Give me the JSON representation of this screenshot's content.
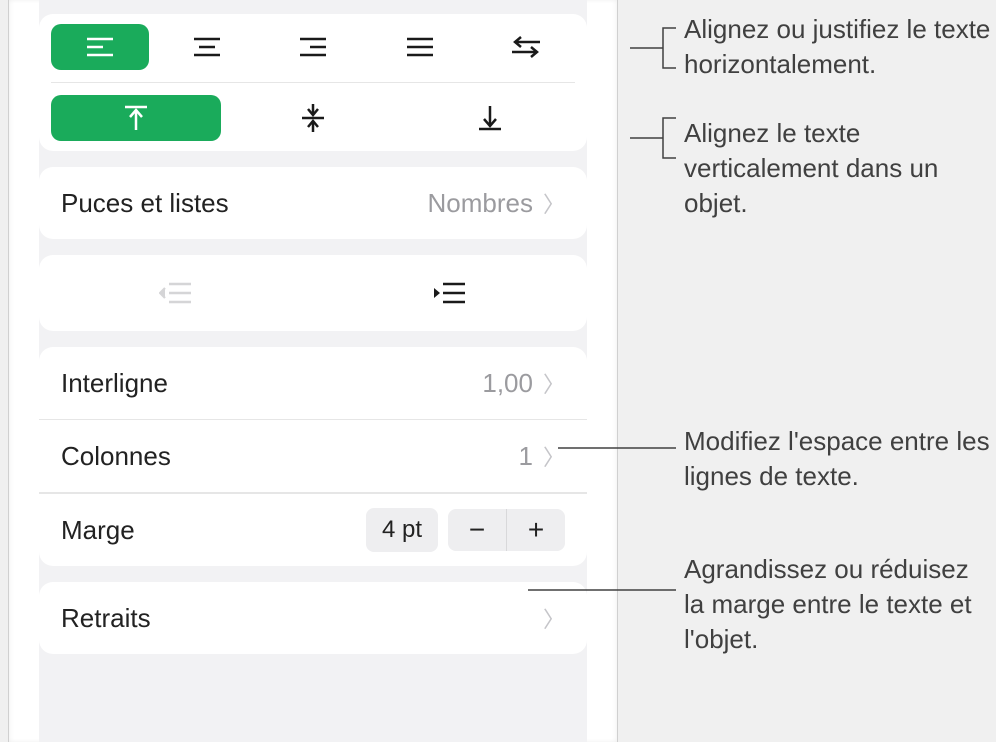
{
  "alignment": {
    "horizontal": [
      "align-left",
      "align-center",
      "align-right",
      "align-justify",
      "align-direction"
    ],
    "vertical": [
      "valign-top",
      "valign-middle",
      "valign-bottom"
    ],
    "active_h": 0,
    "active_v": 0
  },
  "bullets": {
    "label": "Puces et listes",
    "value": "Nombres"
  },
  "indent": {
    "outdent_enabled": false,
    "indent_enabled": true
  },
  "interligne": {
    "label": "Interligne",
    "value": "1,00"
  },
  "colonnes": {
    "label": "Colonnes",
    "value": "1"
  },
  "marge": {
    "label": "Marge",
    "value": "4 pt",
    "minus": "−",
    "plus": "+"
  },
  "retraits": {
    "label": "Retraits"
  },
  "callouts": {
    "h_align": "Alignez ou justifiez le texte horizontalement.",
    "v_align": "Alignez le texte verticalement dans un objet.",
    "interligne": "Modifiez l'espace entre les lignes de texte.",
    "marge": "Agrandissez ou réduisez la marge entre le texte et l'objet."
  }
}
